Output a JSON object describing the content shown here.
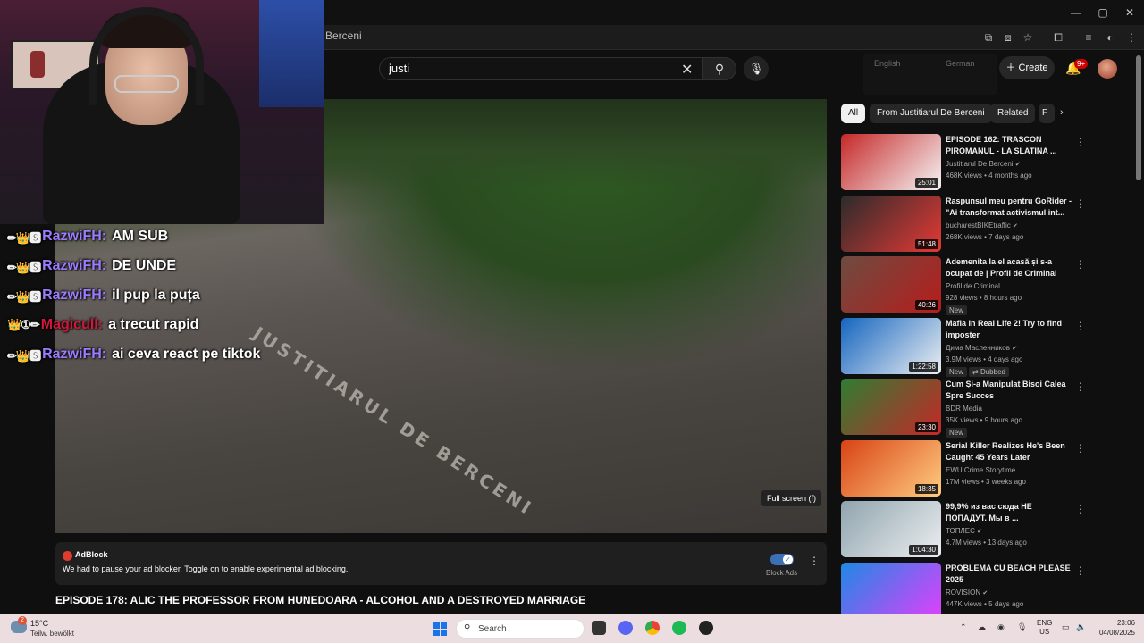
{
  "browser": {
    "url_fragment": "Berceni",
    "window_controls": [
      "—",
      "▢",
      "✕"
    ]
  },
  "youtube": {
    "search": {
      "value": "justi"
    },
    "translate_popup": {
      "lang_1": "English",
      "lang_2": "German"
    },
    "create_label": "Create",
    "notification_count": "9+"
  },
  "player": {
    "watermark": "JUSTITIARUL DE BERCENI",
    "fullscreen_tip": "Full screen (f)"
  },
  "chat": [
    {
      "badges": "✏👑🆂",
      "name": "RazwiFH:",
      "name_color": "#9b7bff",
      "message": "AM SUB"
    },
    {
      "badges": "✏👑🆂",
      "name": "RazwiFH:",
      "name_color": "#9b7bff",
      "message": "DE UNDE"
    },
    {
      "badges": "✏👑🆂",
      "name": "RazwiFH:",
      "name_color": "#9b7bff",
      "message": "il pup la puța"
    },
    {
      "badges": "👑①✏",
      "name": "Magicull:",
      "name_color": "#d4163a",
      "message": "a trecut rapid"
    },
    {
      "badges": "✏👑🆂",
      "name": "RazwiFH:",
      "name_color": "#9b7bff",
      "message": "ai ceva react pe tiktok"
    }
  ],
  "adblock": {
    "title": "AdBlock",
    "message": "We had to pause your ad blocker. Toggle on to enable experimental ad blocking.",
    "toggle_label": "Block Ads"
  },
  "video_title": "EPISODE 178: ALIC THE PROFESSOR FROM HUNEDOARA - ALCOHOL AND A DESTROYED MARRIAGE",
  "chips": [
    "All",
    "From Justitiarul De Berceni",
    "Related",
    "F"
  ],
  "recommendations": [
    {
      "title": "EPISODE 162: TRASCON PIROMANUL - LA SLATINA ...",
      "channel": "Justitiarul De Berceni",
      "verified": true,
      "meta": "468K views • 4 months ago",
      "duration": "25:01",
      "badges": [],
      "thumb_colors": [
        "#c62828",
        "#f5f5f5"
      ]
    },
    {
      "title": "Raspunsul meu pentru GoRider - \"Ai transformat activismul int...",
      "channel": "bucharestBIKEtraffic",
      "verified": true,
      "meta": "268K views • 7 days ago",
      "duration": "51:48",
      "badges": [],
      "thumb_colors": [
        "#2b2b2b",
        "#e53935"
      ]
    },
    {
      "title": "Ademenita la el acasă și s-a ocupat de | Profil de Criminal",
      "channel": "Profil de Criminal",
      "verified": false,
      "meta": "928 views • 8 hours ago",
      "duration": "40:26",
      "badges": [
        "New"
      ],
      "thumb_colors": [
        "#6d4c41",
        "#b71c1c"
      ]
    },
    {
      "title": "Mafia in Real Life 2! Try to find imposter",
      "channel": "Дима Масленников",
      "verified": true,
      "meta": "3.9M views • 4 days ago",
      "duration": "1:22:58",
      "badges": [
        "New",
        "Dubbed"
      ],
      "thumb_colors": [
        "#1565c0",
        "#eceff1"
      ]
    },
    {
      "title": "Cum Și-a Manipulat Bisoi Calea Spre Succes",
      "channel": "BDR Media",
      "verified": false,
      "meta": "35K views • 9 hours ago",
      "duration": "23:30",
      "badges": [
        "New"
      ],
      "thumb_colors": [
        "#2e7d32",
        "#c62828"
      ]
    },
    {
      "title": "Serial Killer Realizes He's Been Caught 45 Years Later",
      "channel": "EWU Crime Storytime",
      "verified": false,
      "meta": "17M views • 3 weeks ago",
      "duration": "18:35",
      "badges": [],
      "thumb_colors": [
        "#d84315",
        "#ffcc80"
      ]
    },
    {
      "title": "99,9% из вас сюда НЕ ПОПАДУТ. Мы в ...",
      "channel": "ТОПЛЕС",
      "verified": true,
      "meta": "4.7M views • 13 days ago",
      "duration": "1:04:30",
      "badges": [],
      "thumb_colors": [
        "#90a4ae",
        "#eceff1"
      ]
    },
    {
      "title": "PROBLEMA CU BEACH PLEASE 2025",
      "channel": "ROVISION",
      "verified": true,
      "meta": "447K views • 5 days ago",
      "duration": "",
      "badges": [],
      "thumb_colors": [
        "#1e88e5",
        "#e040fb"
      ]
    }
  ],
  "taskbar": {
    "weather_temp": "15°C",
    "weather_desc": "Teilw. bewölkt",
    "weather_badge": "2",
    "search_placeholder": "Search",
    "tray_lang": "ENG",
    "tray_region": "US",
    "time": "23:06",
    "date": "04/08/2025"
  }
}
